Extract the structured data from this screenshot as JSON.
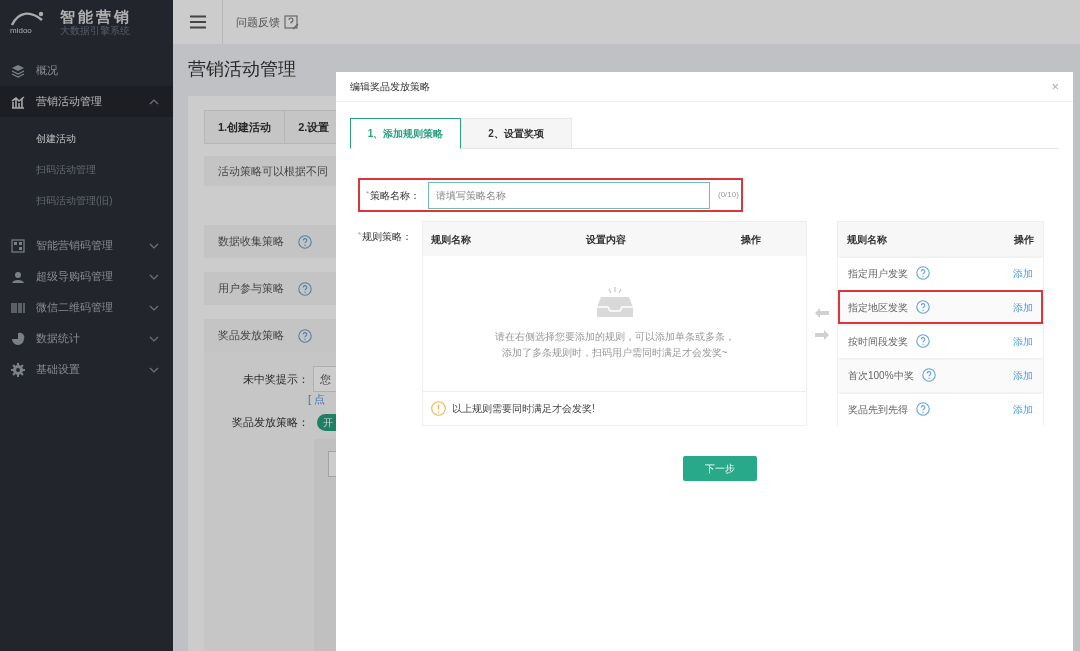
{
  "sidebar": {
    "logo": {
      "brand": "midoo",
      "title": "智能营销",
      "subtitle": "大数据引擎系统"
    },
    "items": [
      {
        "kind": "link",
        "label": "概况",
        "selected": false
      },
      {
        "kind": "group",
        "label": "营销活动管理",
        "expanded": true,
        "children": [
          {
            "label": "创建活动",
            "selected": true
          },
          {
            "label": "扫码活动管理",
            "selected": false
          },
          {
            "label": "扫码活动管理(旧)",
            "selected": false
          }
        ]
      },
      {
        "kind": "group",
        "label": "智能营销码管理",
        "expanded": false
      },
      {
        "kind": "group",
        "label": "超级导购码管理",
        "expanded": false
      },
      {
        "kind": "group",
        "label": "微信二维码管理",
        "expanded": false
      },
      {
        "kind": "group",
        "label": "数据统计",
        "expanded": false
      },
      {
        "kind": "group",
        "label": "基础设置",
        "expanded": false
      }
    ]
  },
  "top_bar": {
    "feedback": "问题反馈"
  },
  "page": {
    "title": "营销活动管理",
    "steps": [
      "1.创建活动",
      "2.设置"
    ],
    "notice": "活动策略可以根据不同",
    "sections": [
      "数据收集策略",
      "用户参与策略",
      "奖品发放策略"
    ],
    "form": {
      "no_win_label": "未中奖提示：",
      "no_win_value": "您",
      "no_win_hint": "[ 点",
      "strategy_label": "奖品发放策略：",
      "toggle": {
        "label": "开",
        "on": true
      }
    }
  },
  "modal": {
    "title": "编辑奖品发放策略",
    "close": "×",
    "tabs": [
      {
        "label": "1、添加规则策略",
        "selected": true
      },
      {
        "label": "2、设置奖项",
        "selected": false
      }
    ],
    "name_field": {
      "label": "策略名称：",
      "required_mark": "*",
      "placeholder": "请填写策略名称",
      "counter": "(0/10)",
      "highlighted": true
    },
    "rules": {
      "label": "规则策略：",
      "required_mark": "*",
      "columns": [
        "规则名称",
        "设置内容",
        "操作"
      ],
      "empty_lines": [
        "请在右侧选择您要添加的规则，可以添加单条或多条，",
        "添加了多条规则时，扫码用户需同时满足才会发奖~"
      ],
      "warning": "以上规则需要同时满足才会发奖!"
    },
    "available": {
      "columns": [
        "规则名称",
        "操作"
      ],
      "rows": [
        {
          "name": "指定用户发奖",
          "action": "添加",
          "highlighted": false
        },
        {
          "name": "指定地区发奖",
          "action": "添加",
          "highlighted": true
        },
        {
          "name": "按时间段发奖",
          "action": "添加",
          "highlighted": false
        },
        {
          "name": "首次100%中奖",
          "action": "添加",
          "highlighted": false
        },
        {
          "name": "奖品先到先得",
          "action": "添加",
          "highlighted": false
        }
      ]
    },
    "next_button": "下一步"
  }
}
